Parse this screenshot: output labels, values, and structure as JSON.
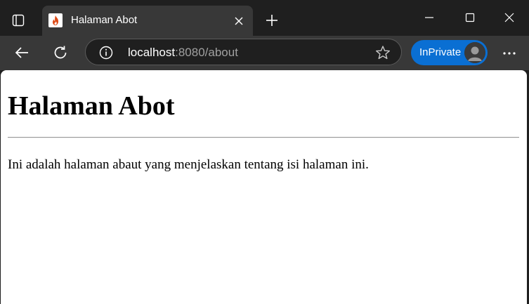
{
  "tab": {
    "title": "Halaman Abot",
    "favicon_icon": "codeigniter-flame-icon",
    "favicon_color": "#dd4814"
  },
  "address_bar": {
    "host": "localhost",
    "port_path": ":8080/about"
  },
  "profile": {
    "label": "InPrivate",
    "color": "#0a6fd3"
  },
  "page": {
    "heading": "Halaman Abot",
    "paragraph": "Ini adalah halaman abaut yang menjelaskan tentang isi halaman ini."
  },
  "theme": {
    "frame": "#1f1f1f",
    "toolbar": "#383838"
  }
}
